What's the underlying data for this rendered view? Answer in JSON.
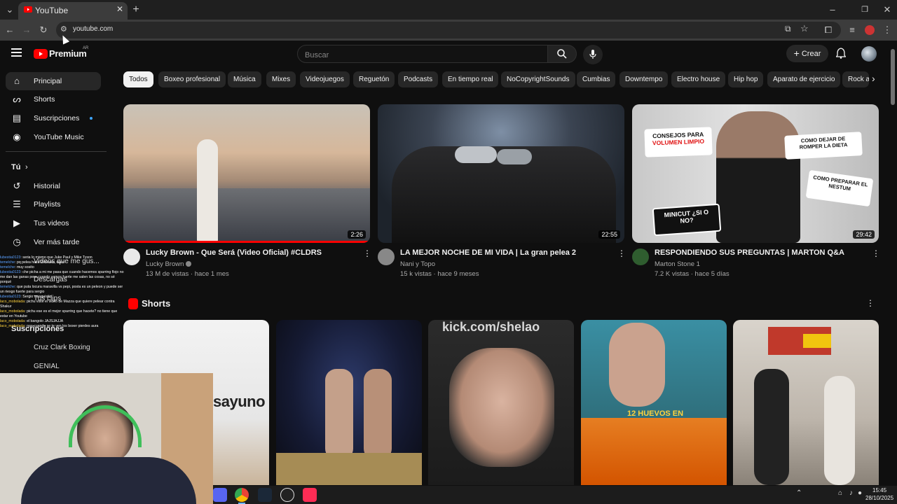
{
  "browser": {
    "tab_title": "YouTube",
    "url": "youtube.com"
  },
  "header": {
    "logo_text": "Premium",
    "region": "AR",
    "search_placeholder": "Buscar",
    "create_label": "Crear"
  },
  "sidebar": {
    "items": [
      {
        "label": "Principal",
        "icon": "home-icon"
      },
      {
        "label": "Shorts",
        "icon": "shorts-icon"
      },
      {
        "label": "Suscripciones",
        "icon": "subscriptions-icon"
      },
      {
        "label": "YouTube Music",
        "icon": "music-icon"
      }
    ],
    "you_heading": "Tú",
    "you_items": [
      {
        "label": "Historial",
        "icon": "history-icon"
      },
      {
        "label": "Playlists",
        "icon": "playlists-icon"
      },
      {
        "label": "Tus videos",
        "icon": "your-videos-icon"
      },
      {
        "label": "Ver más tarde",
        "icon": "watch-later-icon"
      }
    ],
    "overlapped_items": [
      "Videos que me gus...",
      "Descargas",
      "Tus clips",
      "Suscripciones",
      "Cruz Clark Boxing",
      "GENIAL"
    ]
  },
  "chips": [
    "Todos",
    "Boxeo profesional",
    "Música",
    "Mixes",
    "Videojuegos",
    "Reguetón",
    "Podcasts",
    "En tiempo real",
    "NoCopyrightSounds",
    "Cumbias",
    "Downtempo",
    "Electro house",
    "Hip hop",
    "Aparato de ejercicio",
    "Rock al"
  ],
  "videos": [
    {
      "title": "Lucky Brown - Que Será (Video Oficial) #CLDRS",
      "channel": "Lucky Brown",
      "meta": "13 M de vistas · hace 1 mes",
      "duration": "2:26",
      "verified": true
    },
    {
      "title": "LA MEJOR NOCHE DE MI VIDA  | La gran pelea 2",
      "channel": "Nani y Topo",
      "meta": "15 k vistas · hace 9 meses",
      "duration": "22:55",
      "verified": false
    },
    {
      "title": "RESPONDIENDO SUS PREGUNTAS | MARTON Q&A",
      "channel": "Marton Stone 1",
      "meta": "7.2 K vistas · hace 5 días",
      "duration": "29:42",
      "verified": false
    }
  ],
  "thumb3_text": {
    "a": "CONSEJOS PARA",
    "b": "VOLUMEN LIMPIO",
    "c": "COMO DEJAR DE ROMPER LA DIETA",
    "d": "COMO PREPARAR EL NESTUM",
    "e": "MINICUT ¿SI O NO?"
  },
  "shorts_heading": "Shorts",
  "shorts_text": {
    "s1": "sayuno",
    "s3": "kick.com/shelao",
    "s4": "12 HUEVOS EN"
  },
  "chat": [
    {
      "user": "lubestia0123",
      "msg": ": seria lo mismo que Juke Paul y Mike Tyson"
    },
    {
      "user": "temelche",
      "msg": ": pq pelea hace 2 meses, claro"
    },
    {
      "user": "temelche",
      "msg": ": muy sosito"
    },
    {
      "user": "lubestia0123",
      "msg": ": che picha a mi me pasa que cuando hacemos sparring flojo no me dan las ganas pero cuando vamos fuerte me salen las cosas, no sé porqué"
    },
    {
      "user": "temelche",
      "msg": ": que puta locura maravilla vs pepi, posta es un peleon y puede ser un riesgo fuerte para sergio"
    },
    {
      "user": "lubestia0123",
      "msg": ": Sergio masquisito"
    },
    {
      "user": "laco_mobolada",
      "msg": ": pichu viste el video de Mazza que quiere pelear contra Shakur"
    },
    {
      "user": "laco_mobolada",
      "msg": ": pichu ese es el mejor sparring que hacete? no tiene que estar en Youtube"
    },
    {
      "user": "laco_mobolada",
      "msg": ": el bangolo JAJSJAJJA"
    },
    {
      "user": "laco_mobolada",
      "msg": ": naa cuando se te ven los boxer pierdes aura"
    }
  ],
  "tray": {
    "time": "15:45",
    "date": "28/10/2025"
  },
  "colors": {
    "accent_red": "#ff0000",
    "background": "#0f0f0f",
    "chip_bg": "#272727"
  }
}
